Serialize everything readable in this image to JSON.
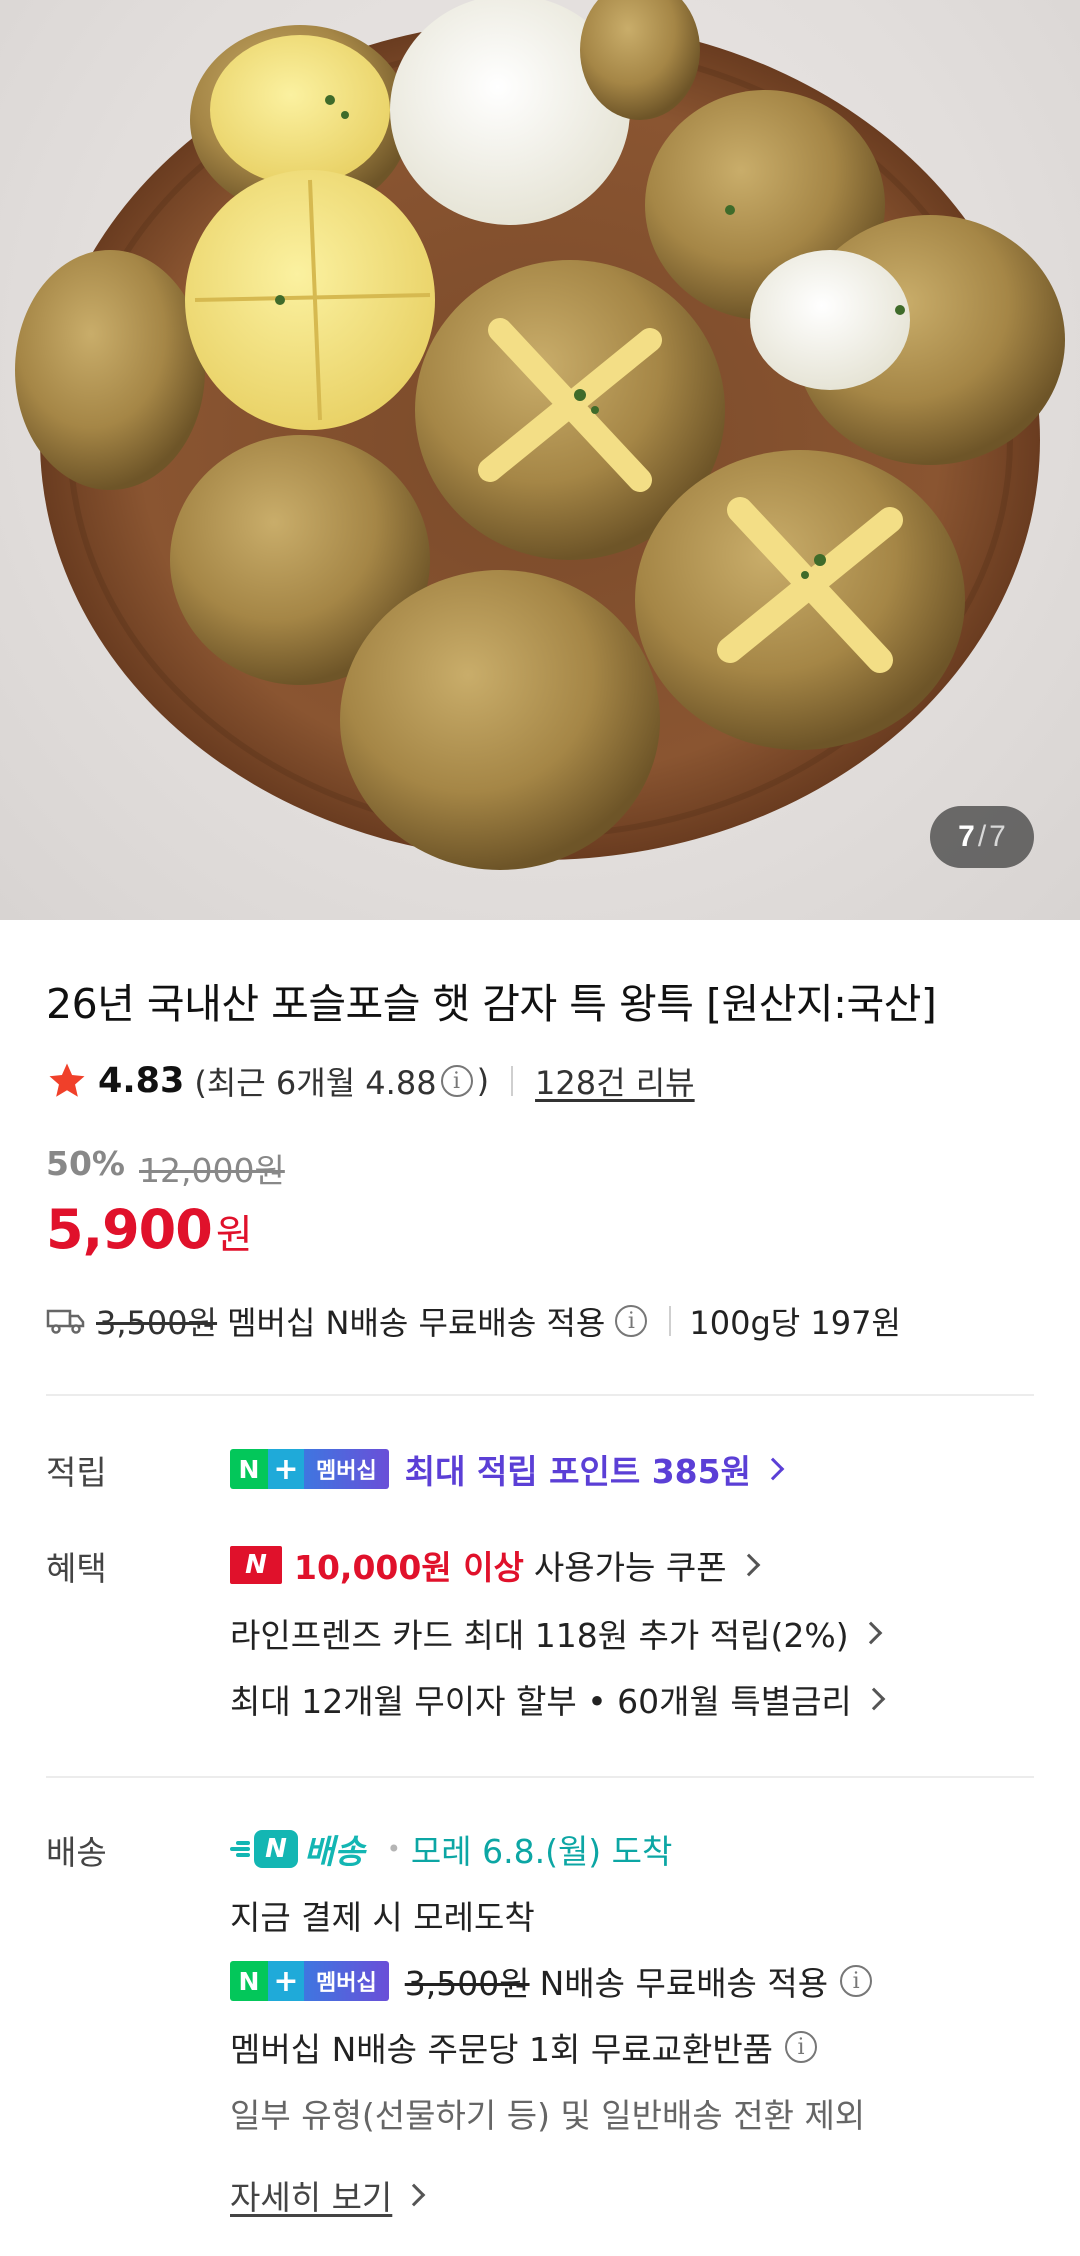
{
  "gallery": {
    "current": "7",
    "separator": "/",
    "total": "7"
  },
  "product": {
    "title": "26년 국내산 포슬포슬 햇 감자 특 왕특 [원산지:국산]",
    "rating": "4.83",
    "recent_rating_text": "(최근 6개월 4.88",
    "recent_rating_close": ")",
    "review_link": "128건 리뷰",
    "discount": "50%",
    "original_price": "12,000원",
    "price": "5,900",
    "price_unit": "원",
    "shipping_fee": "3,500원",
    "shipping_text": "멤버십 N배송 무료배송 적용",
    "unit_price": "100g당 197원"
  },
  "points": {
    "label": "적립",
    "badge_n": "N",
    "badge_plus": "+",
    "badge_membership": "멤버십",
    "text": "최대 적립 포인트 385원"
  },
  "benefits": {
    "label": "혜택",
    "coupon_badge": "N",
    "coupon_amount": "10,000원 이상",
    "coupon_text": "사용가능 쿠폰",
    "card_text": "라인프렌즈 카드 최대 118원 추가 적립(2%)",
    "installment_text": "최대 12개월 무이자 할부 • 60개월 특별금리"
  },
  "delivery": {
    "label": "배송",
    "logo_n": "N",
    "logo_text": "배송",
    "dot": "•",
    "arrival": "모레 6.8.(월) 도착",
    "pay_now": "지금 결제 시 모레도착",
    "badge_n": "N",
    "badge_plus": "+",
    "badge_membership": "멤버십",
    "fee": "3,500원",
    "free_text": "N배송 무료배송 적용",
    "exchange_text": "멤버십 N배송 주문당 1회 무료교환반품",
    "exclusion_text": "일부 유형(선물하기 등) 및 일반배송 전환 제외",
    "detail_link": "자세히 보기"
  },
  "colors": {
    "price_red": "#e0112b",
    "membership_purple": "#5b3fd6",
    "naver_green": "#03c75a",
    "delivery_teal": "#13b6b3"
  }
}
